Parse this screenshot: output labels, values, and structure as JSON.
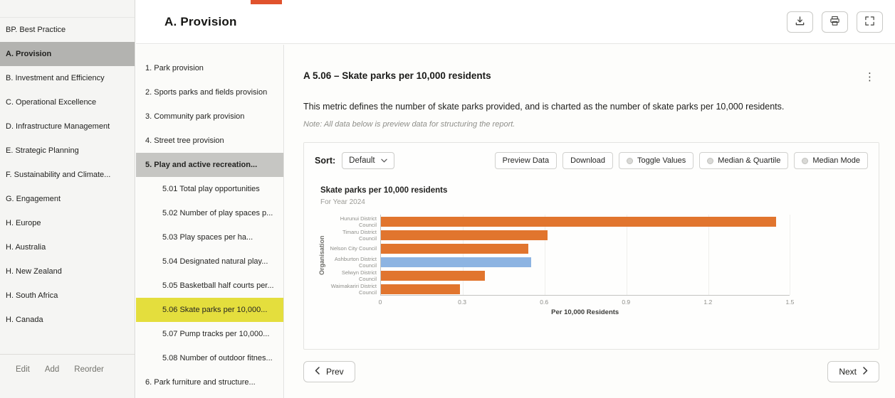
{
  "top_accent": {
    "color": "#e0522d"
  },
  "colors": {
    "sidebar_selected_bg": "#b3b3b0",
    "subnav_selected_bg": "#c6c6c3",
    "subnav_highlight_bg": "#e4de3d"
  },
  "left_sidebar": {
    "items": [
      {
        "label": "BP. Best Practice",
        "selected": false
      },
      {
        "label": "A. Provision",
        "selected": true
      },
      {
        "label": "B. Investment and Efficiency",
        "selected": false
      },
      {
        "label": "C. Operational Excellence",
        "selected": false
      },
      {
        "label": "D. Infrastructure Management",
        "selected": false
      },
      {
        "label": "E. Strategic Planning",
        "selected": false
      },
      {
        "label": "F. Sustainability and Climate...",
        "selected": false
      },
      {
        "label": "G. Engagement",
        "selected": false
      },
      {
        "label": "H. Europe",
        "selected": false
      },
      {
        "label": "H. Australia",
        "selected": false
      },
      {
        "label": "H. New Zealand",
        "selected": false
      },
      {
        "label": "H. South Africa",
        "selected": false
      },
      {
        "label": "H. Canada",
        "selected": false
      }
    ],
    "footer_actions": [
      {
        "label": "Edit"
      },
      {
        "label": "Add"
      },
      {
        "label": "Reorder"
      }
    ]
  },
  "header": {
    "title": "A. Provision"
  },
  "subnav": {
    "items": [
      {
        "label": "1. Park provision",
        "level": 1,
        "selected": false,
        "highlighted": false
      },
      {
        "label": "2. Sports parks and fields provision",
        "level": 1,
        "selected": false,
        "highlighted": false
      },
      {
        "label": "3. Community park provision",
        "level": 1,
        "selected": false,
        "highlighted": false
      },
      {
        "label": "4. Street tree provision",
        "level": 1,
        "selected": false,
        "highlighted": false
      },
      {
        "label": "5. Play and active recreation...",
        "level": 1,
        "selected": true,
        "highlighted": false
      },
      {
        "label": "5.01 Total play opportunities",
        "level": 2,
        "selected": false,
        "highlighted": false
      },
      {
        "label": "5.02 Number of play spaces p...",
        "level": 2,
        "selected": false,
        "highlighted": false
      },
      {
        "label": "5.03 Play spaces per ha...",
        "level": 2,
        "selected": false,
        "highlighted": false
      },
      {
        "label": "5.04 Designated natural play...",
        "level": 2,
        "selected": false,
        "highlighted": false
      },
      {
        "label": "5.05 Basketball half courts per...",
        "level": 2,
        "selected": false,
        "highlighted": false
      },
      {
        "label": "5.06 Skate parks per 10,000...",
        "level": 2,
        "selected": false,
        "highlighted": true
      },
      {
        "label": "5.07 Pump tracks per 10,000...",
        "level": 2,
        "selected": false,
        "highlighted": false
      },
      {
        "label": "5.08 Number of outdoor fitnes...",
        "level": 2,
        "selected": false,
        "highlighted": false
      },
      {
        "label": "6. Park furniture and structure...",
        "level": 1,
        "selected": false,
        "highlighted": false
      }
    ]
  },
  "metric": {
    "title": "A 5.06 – Skate parks per 10,000 residents",
    "description": "This metric defines the number of skate parks provided, and is charted as the number of skate parks per 10,000 residents.",
    "note": "Note: All data below is preview data for structuring the report.",
    "menu_icon": "⋮"
  },
  "chart_controls": {
    "sort_label": "Sort:",
    "sort_value": "Default",
    "buttons": [
      {
        "label": "Preview Data",
        "has_radio": false
      },
      {
        "label": "Download",
        "has_radio": false
      },
      {
        "label": "Toggle Values",
        "has_radio": true
      },
      {
        "label": "Median & Quartile",
        "has_radio": true
      },
      {
        "label": "Median Mode",
        "has_radio": true
      }
    ]
  },
  "chart_data": {
    "type": "bar",
    "orientation": "horizontal",
    "title": "Skate parks per 10,000 residents",
    "subtitle": "For Year 2024",
    "xlabel": "Per 10,000 Residents",
    "ylabel": "Organisation",
    "categories": [
      "Hurunui District Council",
      "Timaru District Council",
      "Nelson City Council",
      "Ashburton District Council",
      "Selwyn District Council",
      "Waimakariri District Council"
    ],
    "values": [
      1.45,
      0.61,
      0.54,
      0.55,
      0.38,
      0.29
    ],
    "bar_colors": [
      "#e1752e",
      "#e1752e",
      "#e1752e",
      "#8db4e2",
      "#e1752e",
      "#e1752e"
    ],
    "default_color": "#e1752e",
    "highlight_color": "#8db4e2",
    "xlim": [
      0,
      1.5
    ],
    "xticks": [
      0,
      0.3,
      0.6,
      0.9,
      1.2,
      1.5
    ],
    "grid": true,
    "legend": "none"
  },
  "pagination": {
    "prev_label": "Prev",
    "next_label": "Next"
  }
}
